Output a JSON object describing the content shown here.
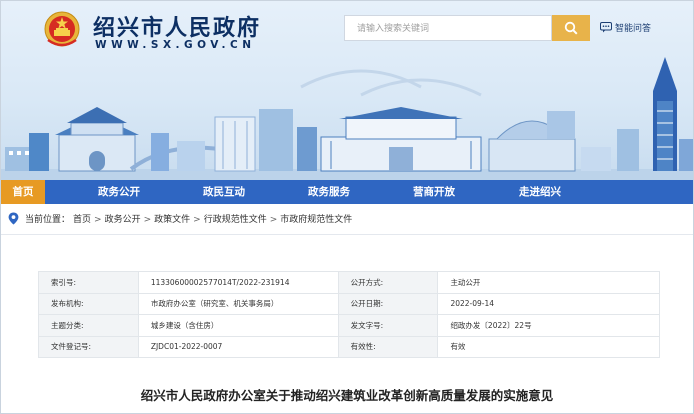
{
  "header": {
    "site_name": "绍兴市人民政府",
    "site_domain": "WWW.SX.GOV.CN",
    "search": {
      "placeholder": "请输入搜索关键词"
    },
    "smart_qa_label": "智能问答"
  },
  "nav": {
    "items": [
      {
        "label": "首页",
        "active": true
      },
      {
        "label": "政务公开"
      },
      {
        "label": "政民互动"
      },
      {
        "label": "政务服务"
      },
      {
        "label": "营商开放"
      },
      {
        "label": "走进绍兴"
      }
    ]
  },
  "breadcrumb": {
    "label": "当前位置：",
    "items": [
      "首页",
      "政务公开",
      "政策文件",
      "行政规范性文件",
      "市政府规范性文件"
    ]
  },
  "doc_info": {
    "rows": [
      {
        "k1": "索引号:",
        "v1": "11330600002577014T/2022-231914",
        "k2": "公开方式:",
        "v2": "主动公开"
      },
      {
        "k1": "发布机构:",
        "v1": "市政府办公室（研究室、机关事务局）",
        "k2": "公开日期:",
        "v2": "2022-09-14"
      },
      {
        "k1": "主题分类:",
        "v1": "城乡建设（含住房）",
        "k2": "发文字号:",
        "v2": "绍政办发〔2022〕22号"
      },
      {
        "k1": "文件登记号:",
        "v1": "ZJDC01-2022-0007",
        "k2": "有效性:",
        "v2": "有效"
      }
    ]
  },
  "document": {
    "title": "绍兴市人民政府办公室关于推动绍兴建筑业改革创新高质量发展的实施意见"
  },
  "colors": {
    "nav_bg": "#2f66c2",
    "nav_active": "#e79a23",
    "search_button": "#e8b34a",
    "brand_text": "#0d2f63"
  }
}
